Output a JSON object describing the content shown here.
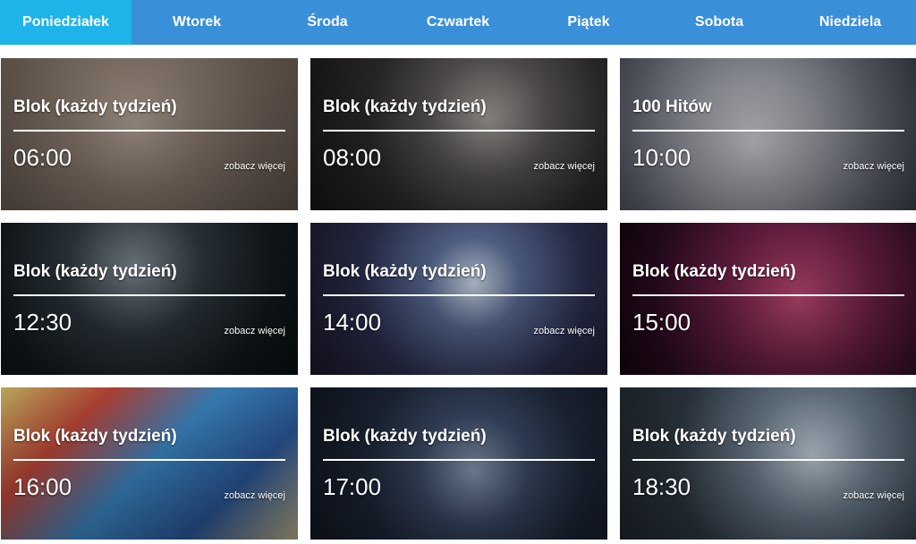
{
  "tabs": [
    {
      "label": "Poniedziałek",
      "active": true
    },
    {
      "label": "Wtorek",
      "active": false
    },
    {
      "label": "Środa",
      "active": false
    },
    {
      "label": "Czwartek",
      "active": false
    },
    {
      "label": "Piątek",
      "active": false
    },
    {
      "label": "Sobota",
      "active": false
    },
    {
      "label": "Niedziela",
      "active": false
    }
  ],
  "cards": [
    {
      "title": "Blok (każdy tydzień)",
      "time": "06:00",
      "more": "zobacz więcej"
    },
    {
      "title": "Blok (każdy tydzień)",
      "time": "08:00",
      "more": "zobacz więcej"
    },
    {
      "title": "100 Hitów",
      "time": "10:00",
      "more": "zobacz więcej"
    },
    {
      "title": "Blok (każdy tydzień)",
      "time": "12:30",
      "more": "zobacz więcej"
    },
    {
      "title": "Blok (każdy tydzień)",
      "time": "14:00",
      "more": "zobacz więcej"
    },
    {
      "title": "Blok (każdy tydzień)",
      "time": "15:00",
      "more": ""
    },
    {
      "title": "Blok (każdy tydzień)",
      "time": "16:00",
      "more": "zobacz więcej"
    },
    {
      "title": "Blok (każdy tydzień)",
      "time": "17:00",
      "more": ""
    },
    {
      "title": "Blok (każdy tydzień)",
      "time": "18:30",
      "more": "zobacz więcej"
    }
  ],
  "colors": {
    "tab_bar": "#3a8fd9",
    "tab_active": "#1eb4ea",
    "text": "#ffffff"
  }
}
